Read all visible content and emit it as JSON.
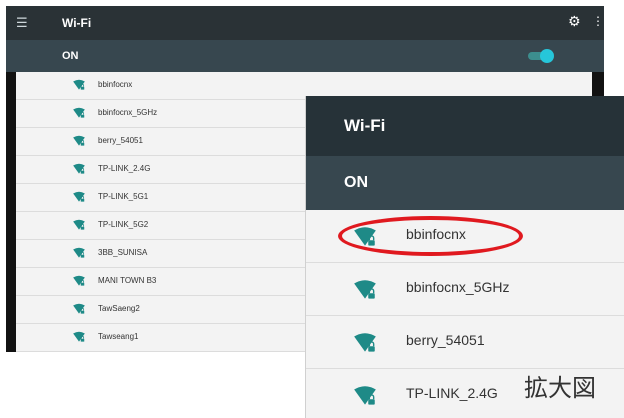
{
  "app": {
    "title": "Wi-Fi",
    "switch_label": "ON",
    "switch_on": true,
    "accent_color": "#26c6da",
    "icons": {
      "menu": "hamburger-menu-icon",
      "settings": "gear-icon",
      "overflow": "more-vert-icon",
      "network": "wifi-lock-icon"
    }
  },
  "networks": [
    {
      "ssid": "bbinfocnx"
    },
    {
      "ssid": "bbinfocnx_5GHz"
    },
    {
      "ssid": "berry_54051"
    },
    {
      "ssid": "TP-LINK_2.4G"
    },
    {
      "ssid": "TP-LINK_5G1"
    },
    {
      "ssid": "TP-LINK_5G2"
    },
    {
      "ssid": "3BB_SUNISA"
    },
    {
      "ssid": "MANI TOWN B3"
    },
    {
      "ssid": "TawSaeng2"
    },
    {
      "ssid": "Tawseang1"
    }
  ],
  "zoom": {
    "title": "Wi-Fi",
    "switch_label": "ON",
    "networks": [
      {
        "ssid": "bbinfocnx"
      },
      {
        "ssid": "bbinfocnx_5GHz"
      },
      {
        "ssid": "berry_54051"
      },
      {
        "ssid": "TP-LINK_2.4G"
      }
    ],
    "highlight_color": "#e0191f",
    "caption": "拡大図"
  }
}
